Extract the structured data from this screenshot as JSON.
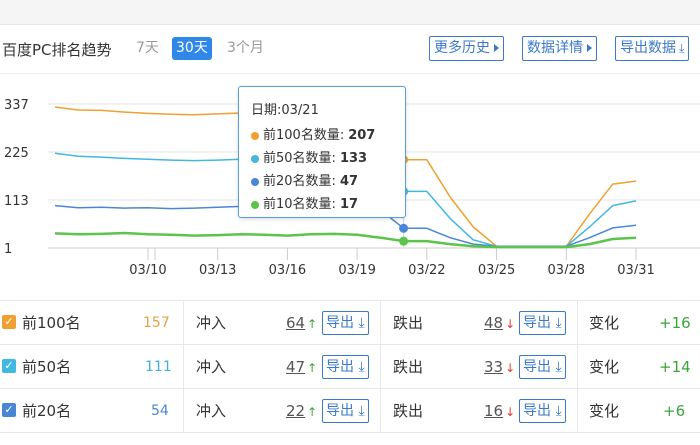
{
  "header": {
    "title": "百度PC排名趋势",
    "ranges": [
      "7天",
      "30天",
      "3个月"
    ],
    "active_range": "30天",
    "buttons": {
      "history": "更多历史",
      "details": "数据详情",
      "export": "导出数据"
    }
  },
  "chart_data": {
    "type": "line",
    "y_ticks": [
      "337",
      "225",
      "113",
      "1"
    ],
    "ylim": [
      1,
      337
    ],
    "x_ticks": [
      "03/10",
      "03/13",
      "03/16",
      "03/19",
      "03/22",
      "03/25",
      "03/28",
      "03/31"
    ],
    "x": [
      "03/06",
      "03/07",
      "03/08",
      "03/09",
      "03/10",
      "03/11",
      "03/12",
      "03/13",
      "03/14",
      "03/15",
      "03/16",
      "03/17",
      "03/18",
      "03/19",
      "03/20",
      "03/21",
      "03/22",
      "03/23",
      "03/24",
      "03/25",
      "03/26",
      "03/27",
      "03/28",
      "03/29",
      "03/30",
      "03/31"
    ],
    "series": [
      {
        "name": "前100名数量",
        "color": "#f0a030",
        "values": [
          330,
          323,
          322,
          318,
          315,
          313,
          312,
          314,
          316,
          315,
          317,
          318,
          318,
          316,
          300,
          207,
          207,
          120,
          50,
          5,
          5,
          5,
          5,
          80,
          150,
          157
        ]
      },
      {
        "name": "前50名数量",
        "color": "#42b8e0",
        "values": [
          222,
          215,
          213,
          210,
          208,
          206,
          205,
          206,
          208,
          207,
          208,
          206,
          205,
          204,
          190,
          133,
          133,
          70,
          20,
          5,
          5,
          5,
          5,
          50,
          100,
          111
        ]
      },
      {
        "name": "前20名数量",
        "color": "#4a86d6",
        "values": [
          100,
          95,
          96,
          94,
          95,
          93,
          94,
          96,
          98,
          97,
          96,
          97,
          96,
          95,
          90,
          47,
          47,
          25,
          10,
          5,
          5,
          5,
          5,
          25,
          48,
          54
        ]
      },
      {
        "name": "前10名数量",
        "color": "#5cc44a",
        "values": [
          35,
          33,
          34,
          36,
          33,
          32,
          30,
          31,
          33,
          32,
          30,
          33,
          34,
          32,
          25,
          17,
          17,
          10,
          5,
          3,
          3,
          3,
          3,
          10,
          22,
          25
        ]
      }
    ],
    "highlight_index": 15,
    "grid": true
  },
  "tooltip": {
    "date_label": "日期:03/21",
    "rows": [
      {
        "label": "前100名数量:",
        "value": "207",
        "color": "#f0a030"
      },
      {
        "label": "前50名数量:",
        "value": "133",
        "color": "#42b8e0"
      },
      {
        "label": "前20名数量:",
        "value": "47",
        "color": "#4a86d6"
      },
      {
        "label": "前10名数量:",
        "value": "17",
        "color": "#5cc44a"
      }
    ]
  },
  "table": {
    "in_label": "冲入",
    "out_label": "跌出",
    "change_label": "变化",
    "export_label": "导出",
    "rows": [
      {
        "name": "前100名",
        "count": "157",
        "count_color": "#e8a040",
        "cb_color": "#f0a030",
        "in": "64",
        "out": "48",
        "change": "+16"
      },
      {
        "name": "前50名",
        "count": "111",
        "count_color": "#42b0d8",
        "cb_color": "#42b8e0",
        "in": "47",
        "out": "33",
        "change": "+14"
      },
      {
        "name": "前20名",
        "count": "54",
        "count_color": "#4a86d6",
        "cb_color": "#4a86d6",
        "in": "22",
        "out": "16",
        "change": "+6"
      }
    ]
  }
}
